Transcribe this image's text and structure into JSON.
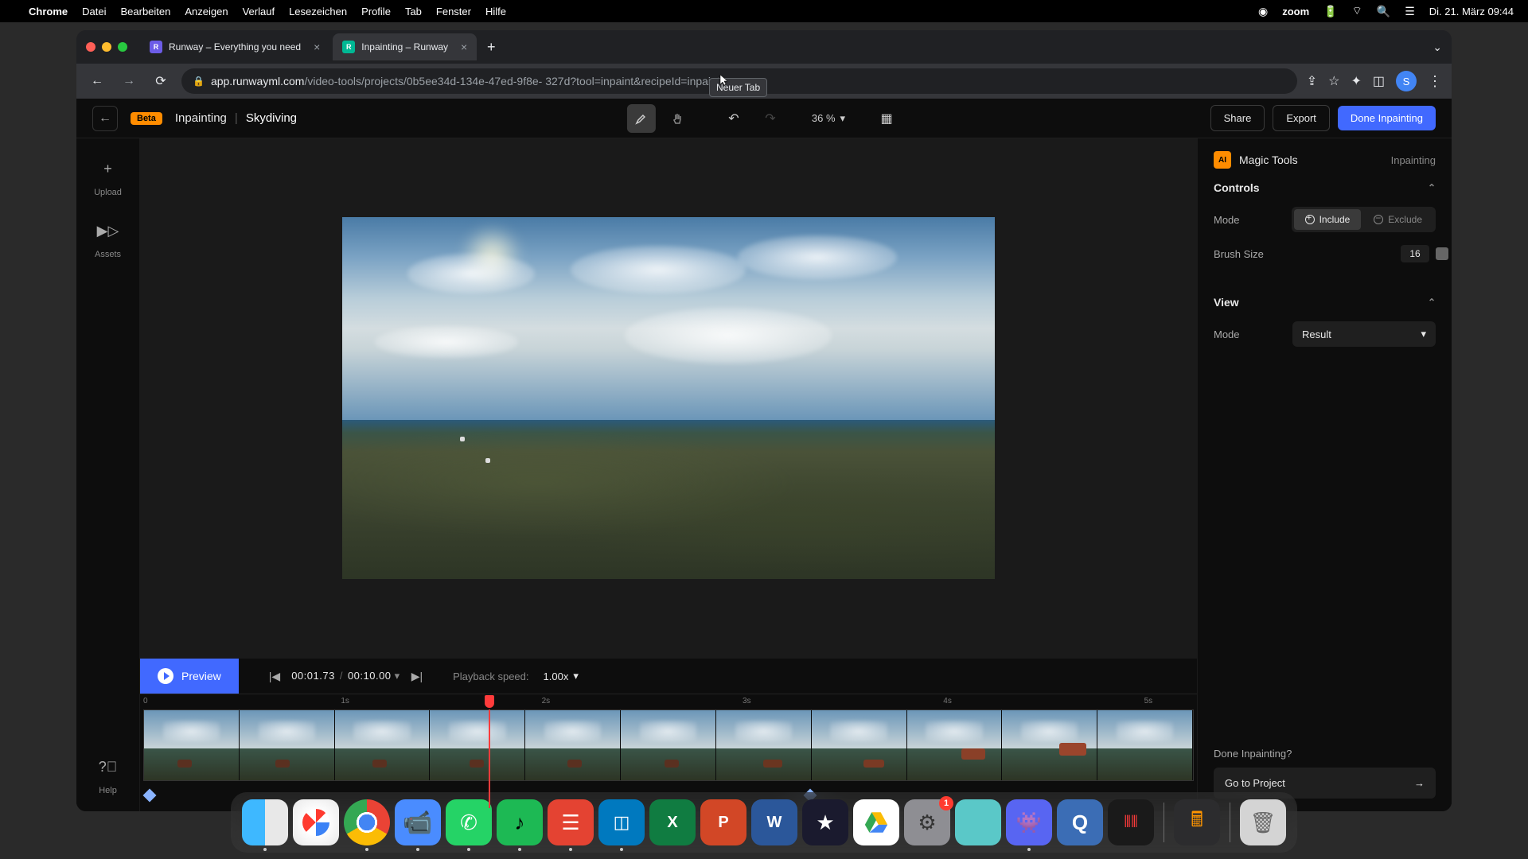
{
  "menubar": {
    "app": "Chrome",
    "items": [
      "Datei",
      "Bearbeiten",
      "Anzeigen",
      "Verlauf",
      "Lesezeichen",
      "Profile",
      "Tab",
      "Fenster",
      "Hilfe"
    ],
    "zoom_brand": "zoom",
    "datetime": "Di. 21. März  09:44"
  },
  "chrome": {
    "tabs": [
      {
        "title": "Runway – Everything you need"
      },
      {
        "title": "Inpainting – Runway"
      }
    ],
    "new_tab_tooltip": "Neuer Tab",
    "url_domain": "app.runwayml.com",
    "url_path": "/video-tools/projects/0b5ee34d-134e-47ed-9f8e-      327d?tool=inpaint&recipeId=inpaint",
    "avatar_letter": "S"
  },
  "app": {
    "beta": "Beta",
    "tool_name": "Inpainting",
    "project_name": "Skydiving",
    "zoom": "36 %",
    "share": "Share",
    "export": "Export",
    "done": "Done Inpainting"
  },
  "sidebar": {
    "upload": "Upload",
    "assets": "Assets",
    "help": "Help"
  },
  "panel": {
    "magic": "Magic Tools",
    "sub": "Inpainting",
    "controls": "Controls",
    "mode_label": "Mode",
    "include": "Include",
    "exclude": "Exclude",
    "brush_label": "Brush Size",
    "brush_value": "16",
    "view": "View",
    "view_mode_label": "Mode",
    "view_mode_value": "Result",
    "done_q": "Done Inpainting?",
    "go": "Go to Project"
  },
  "playback": {
    "preview": "Preview",
    "current": "00:01.73",
    "total": "00:10.00",
    "speed_label": "Playback speed:",
    "speed": "1.00x",
    "ruler": [
      "0",
      "1s",
      "2s",
      "3s",
      "4s",
      "5s"
    ]
  },
  "dock": {
    "settings_badge": "1"
  }
}
